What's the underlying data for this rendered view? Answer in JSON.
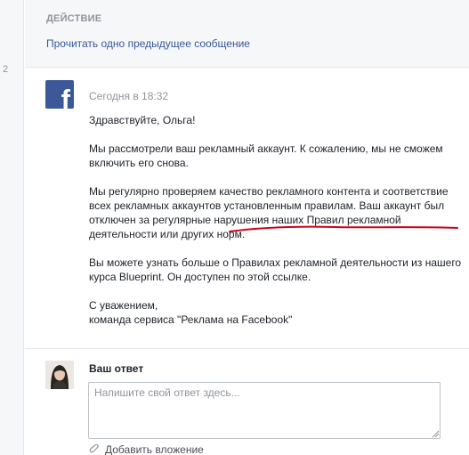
{
  "gutter": {
    "number": "2"
  },
  "action": {
    "heading": "ДЕЙСТВИЕ",
    "link": "Прочитать одно предыдущее сообщение"
  },
  "message": {
    "sender_icon": "facebook-logo",
    "time": "Сегодня в 18:32",
    "greeting": "Здравствуйте, Ольга!",
    "paragraph1": "Мы рассмотрели ваш рекламный аккаунт. К сожалению, мы не сможем включить его снова.",
    "paragraph2": "Мы регулярно проверяем качество рекламного контента и соответствие всех рекламных аккаунтов установленным правилам. Ваш аккаунт был отключен за регулярные нарушения наших Правил рекламной деятельности или других норм.",
    "paragraph3": "Вы можете узнать больше о Правилах рекламной деятельности из нашего курса Blueprint. Он доступен по этой ссылке.",
    "closing_line1": "С уважением,",
    "closing_line2": "команда сервиса \"Реклама на Facebook\""
  },
  "reply": {
    "title": "Ваш ответ",
    "placeholder": "Напишите свой ответ здесь...",
    "attach_label": "Добавить вложение",
    "attach_icon": "paperclip-icon"
  },
  "colors": {
    "facebook_blue": "#3b5998",
    "link": "#365899",
    "muted": "#90949c",
    "annotation_red": "#d0021b"
  }
}
